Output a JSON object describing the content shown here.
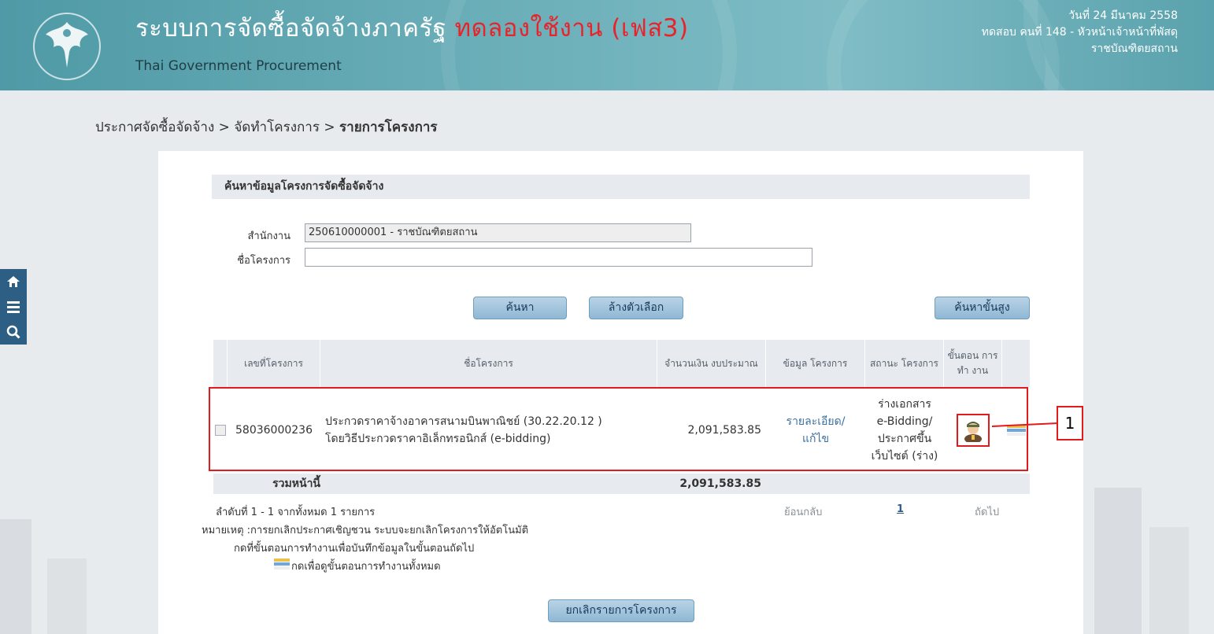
{
  "header": {
    "title_main": "ระบบการจัดซื้อจัดจ้างภาครัฐ",
    "title_test": "ทดลองใช้งาน (เฟส3)",
    "subtitle": "Thai Government Procurement",
    "date": "วันที่ 24 มีนาคม 2558",
    "user": "ทดสอบ คนที่ 148 - หัวหน้าเจ้าหน้าที่พัสดุ",
    "agency": "ราชบัณฑิตยสถาน"
  },
  "breadcrumb": {
    "item1": "ประกาศจัดซื้อจัดจ้าง",
    "sep": ">",
    "item2": "จัดทำโครงการ",
    "item3": "รายการโครงการ"
  },
  "search": {
    "heading": "ค้นหาข้อมูลโครงการจัดซื้อจัดจ้าง",
    "office_label": "สำนักงาน",
    "office_value": "250610000001 - ราชบัณฑิตยสถาน",
    "project_label": "ชื่อโครงการ",
    "project_value": "",
    "search_btn": "ค้นหา",
    "clear_btn": "ล้างตัวเลือก",
    "advanced_btn": "ค้นหาขั้นสูง"
  },
  "table": {
    "headers": {
      "project_no": "เลขที่โครงการ",
      "project_name": "ชื่อโครงการ",
      "budget": "จำนวนเงิน งบประมาณ",
      "info": "ข้อมูล โครงการ",
      "status": "สถานะ โครงการ",
      "step": "ขั้นตอน การทำ งาน"
    },
    "rows": [
      {
        "project_no": "58036000236",
        "name_line1": "ประกวดราคาจ้างอาคารสนามบินพาณิชย์ (30.22.20.12 )",
        "name_line2": "โดยวิธีประกวดราคาอิเล็กทรอนิกส์ (e-bidding)",
        "budget": "2,091,583.85",
        "info_link_1": "รายละเอียด/",
        "info_link_2": "แก้ไข",
        "status_1": "ร่างเอกสาร",
        "status_2": "e-Bidding/",
        "status_3": "ประกาศขึ้น",
        "status_4": "เว็บไซต์ (ร่าง)"
      }
    ],
    "sum_label": "รวมหน้านี้",
    "sum_value": "2,091,583.85"
  },
  "pagination": {
    "summary": "ลำดับที่ 1 - 1 จากทั้งหมด 1 รายการ",
    "prev": "ย้อนกลับ",
    "page": "1",
    "next": "ถัดไป"
  },
  "notes": {
    "line1": "หมายเหตุ :การยกเลิกประกาศเชิญชวน ระบบจะยกเลิกโครงการให้อัตโนมัติ",
    "line2": "กดที่ขั้นตอนการทำงานเพื่อบันทึกข้อมูลในขั้นตอนถัดไป",
    "line3": "กดเพื่อดูขั้นตอนการทำงานทั้งหมด"
  },
  "cancel_btn": "ยกเลิกรายการโครงการ",
  "callout_number": "1",
  "colors": {
    "highlight": "#e11b1b",
    "header_teal": "#5aa2ad",
    "button": "#8fb7d4"
  },
  "icons": [
    "home-icon",
    "menu-icon",
    "search-icon",
    "officer-icon",
    "steps-icon"
  ]
}
